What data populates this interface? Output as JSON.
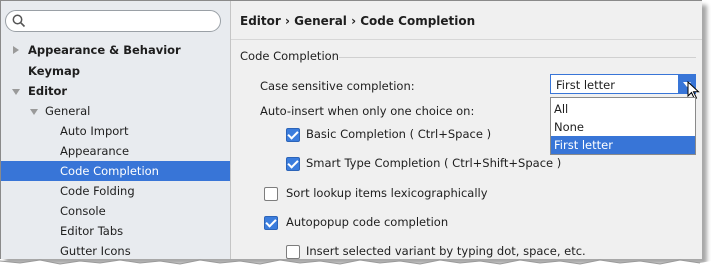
{
  "search": {
    "placeholder": ""
  },
  "sidebar": {
    "items": [
      {
        "label": "Appearance & Behavior"
      },
      {
        "label": "Keymap"
      },
      {
        "label": "Editor"
      },
      {
        "label": "General"
      },
      {
        "label": "Auto Import"
      },
      {
        "label": "Appearance"
      },
      {
        "label": "Code Completion"
      },
      {
        "label": "Code Folding"
      },
      {
        "label": "Console"
      },
      {
        "label": "Editor Tabs"
      },
      {
        "label": "Gutter Icons"
      }
    ]
  },
  "breadcrumb": "Editor › General › Code Completion",
  "section_title": "Code Completion",
  "case_sensitive": {
    "label": "Case sensitive completion:",
    "value": "First letter",
    "options": [
      "All",
      "None",
      "First letter"
    ]
  },
  "auto_insert_label": "Auto-insert when only one choice on:",
  "options": {
    "basic": "Basic Completion ( Ctrl+Space )",
    "smart": "Smart Type Completion ( Ctrl+Shift+Space )",
    "sort": "Sort lookup items lexicographically",
    "autopopup": "Autopopup code completion",
    "insert_variant": "Insert selected variant by typing dot, space, etc."
  },
  "colors": {
    "selection": "#3875d7",
    "checkbox": "#3b7ddd"
  },
  "icons": [
    "search-icon",
    "expand-arrow-icon",
    "collapse-arrow-icon",
    "dropdown-arrow-icon",
    "mouse-cursor-icon"
  ]
}
